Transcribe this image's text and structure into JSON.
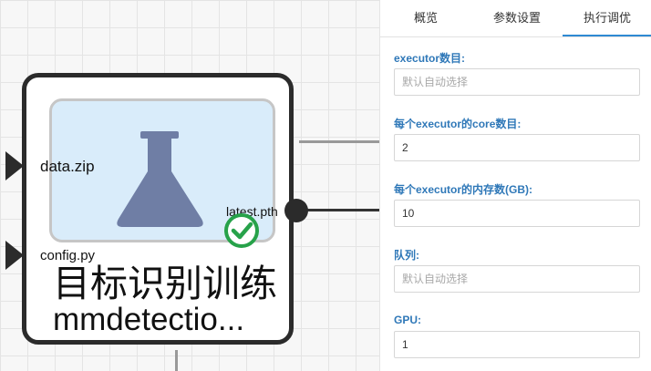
{
  "canvas": {
    "node": {
      "title": "目标识别训练",
      "subtitle": "mmdetectio...",
      "inputs": [
        {
          "label": "data.zip"
        },
        {
          "label": "config.py"
        }
      ],
      "output": {
        "label": "latest.pth"
      },
      "status": "success"
    }
  },
  "panel": {
    "tabs": [
      {
        "label": "概览"
      },
      {
        "label": "参数设置"
      },
      {
        "label": "执行调优"
      }
    ],
    "active_tab": "执行调优",
    "accent_color": "#2f8ad3",
    "fields": [
      {
        "label": "executor数目:",
        "value": "",
        "placeholder": "默认自动选择"
      },
      {
        "label": "每个executor的core数目:",
        "value": "2",
        "placeholder": ""
      },
      {
        "label": "每个executor的内存数(GB):",
        "value": "10",
        "placeholder": ""
      },
      {
        "label": "队列:",
        "value": "",
        "placeholder": "默认自动选择"
      },
      {
        "label": "GPU:",
        "value": "1",
        "placeholder": ""
      }
    ]
  }
}
